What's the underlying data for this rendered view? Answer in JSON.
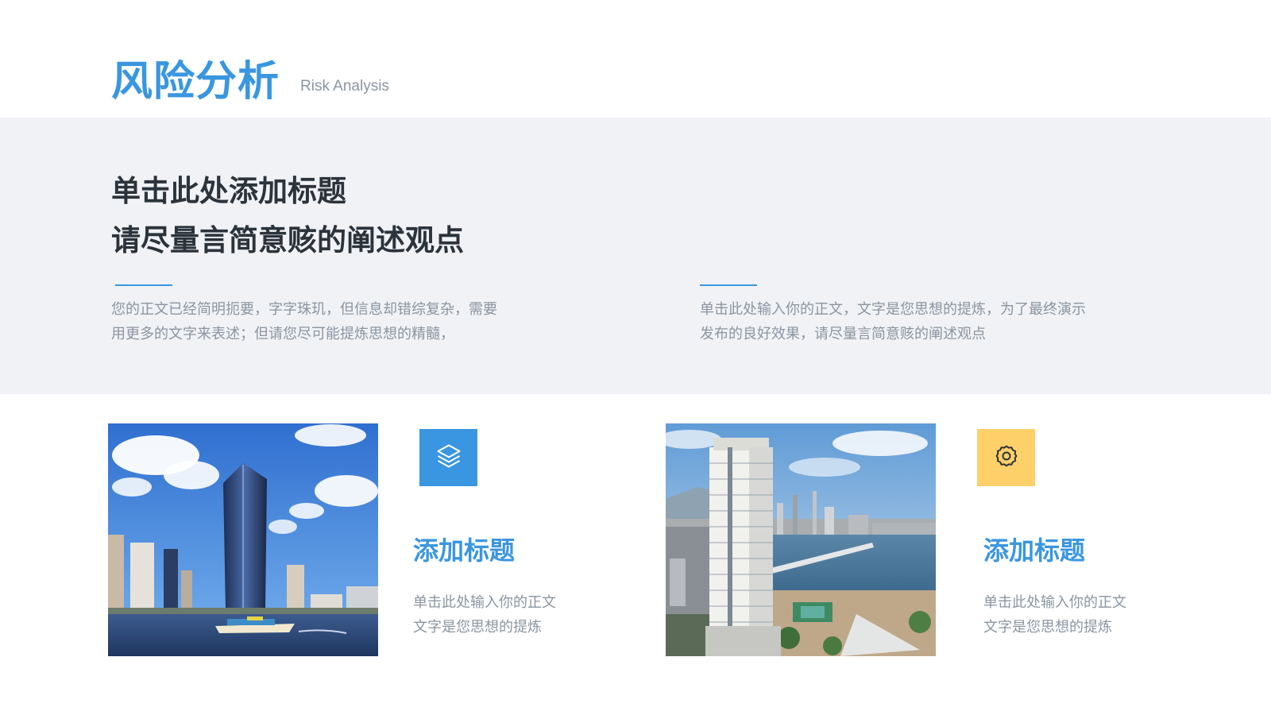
{
  "header": {
    "title": "风险分析",
    "subtitle": "Risk Analysis"
  },
  "intro": {
    "headline": [
      "单击此处添加标题",
      "请尽量言简意赅的阐述观点"
    ],
    "left_text": [
      "您的正文已经简明扼要，字字珠玑，但信息却错综复杂，需要",
      "用更多的文字来表述；但请您尽可能提炼思想的精髓，"
    ],
    "right_text": [
      "单击此处输入你的正文，文字是您思想的提炼，为了最终演示",
      "发布的良好效果，请尽量言简意赅的阐述观点"
    ]
  },
  "cards": [
    {
      "icon": "layers-icon",
      "icon_color": "#3a96e0",
      "title": "添加标题",
      "text": [
        "单击此处输入你的正文",
        "文字是您思想的提炼"
      ]
    },
    {
      "icon": "gear-icon",
      "icon_color": "#fdd069",
      "title": "添加标题",
      "text": [
        "单击此处输入你的正文",
        "文字是您思想的提炼"
      ]
    }
  ],
  "colors": {
    "accent": "#3a96e0",
    "heading": "#2b333b",
    "body_text": "#8b95a1",
    "band": "#f0f2f5"
  }
}
